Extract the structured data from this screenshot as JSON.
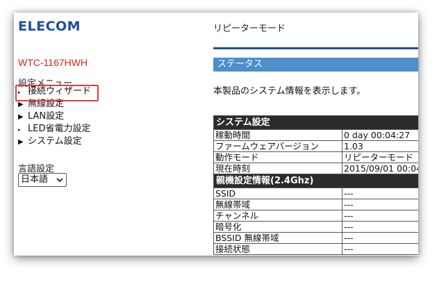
{
  "header": {
    "logo": "ELECOM",
    "mode_title": "リピーターモード"
  },
  "sidebar": {
    "model": "WTC-1167HWH",
    "menu_heading": "設定メニュー",
    "items": [
      {
        "label": "接続ウィザード",
        "marker": "▸"
      },
      {
        "label": "無線設定",
        "marker": "▶"
      },
      {
        "label": "LAN設定",
        "marker": "▶"
      },
      {
        "label": "LED省電力設定",
        "marker": "▸"
      },
      {
        "label": "システム設定",
        "marker": "▶"
      }
    ],
    "language_label": "言語設定",
    "language_value": "日本語",
    "language_chevron": "chevron-down-icon"
  },
  "main": {
    "status_heading": "ステータス",
    "description": "本製品のシステム情報を表示します。",
    "sections": [
      {
        "title": "システム設定",
        "rows": [
          {
            "key": "稼動時間",
            "value": "0 day 00:04:27"
          },
          {
            "key": "ファームウェアバージョン",
            "value": "1.03"
          },
          {
            "key": "動作モード",
            "value": "リピーターモード"
          },
          {
            "key": "現在時刻",
            "value": "2015/09/01 00:04"
          }
        ]
      },
      {
        "title": "親機設定情報(2.4Ghz)",
        "rows": [
          {
            "key": "SSID",
            "value": "---"
          },
          {
            "key": "無線帯域",
            "value": "---"
          },
          {
            "key": "チャンネル",
            "value": "---"
          },
          {
            "key": "暗号化",
            "value": "---"
          },
          {
            "key": "BSSID 無線帯域",
            "value": "---"
          },
          {
            "key": "接続状態",
            "value": "---"
          }
        ]
      }
    ]
  },
  "colors": {
    "brand": "#1f4ea0",
    "model_red": "#e0201b",
    "status_bar": "#4d8ecb",
    "section_header": "#2b2b2b",
    "highlight_box": "#e83a3a"
  }
}
